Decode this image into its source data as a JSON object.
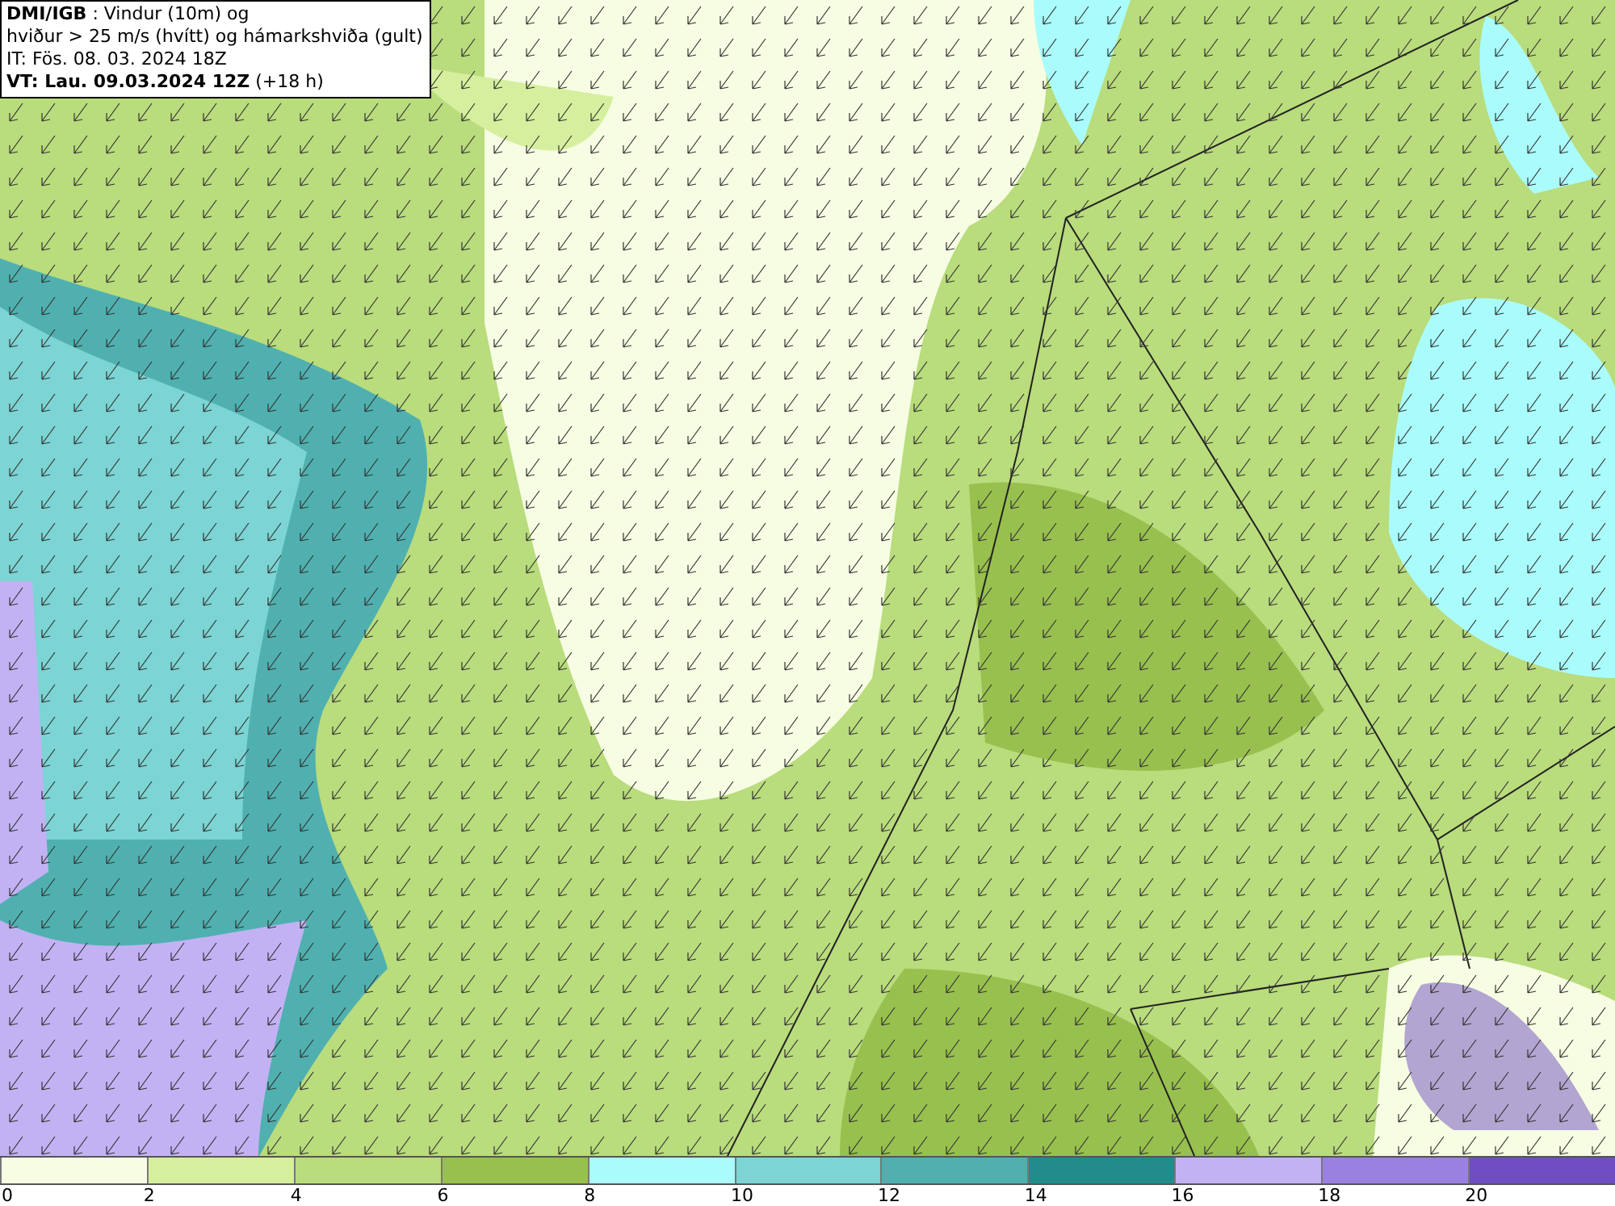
{
  "title_box": {
    "lines": [
      "**DMI/IGB** : Vindur (10m) og",
      "hviður > 25 m/s (hvítt) og hámarkshviða (gult)",
      "IT: Fös. 08. 03. 2024 18Z",
      "**VT: Lau. 09.03.2024 12Z** (+18 h)"
    ]
  },
  "legend": {
    "bins": [
      {
        "label": "0",
        "color": "#f6fde2"
      },
      {
        "label": "2",
        "color": "#d6ef9e"
      },
      {
        "label": "4",
        "color": "#b9dc7c"
      },
      {
        "label": "6",
        "color": "#98c04e"
      },
      {
        "label": "8",
        "color": "#aafcfc"
      },
      {
        "label": "10",
        "color": "#7cd4d4"
      },
      {
        "label": "12",
        "color": "#50b0b0"
      },
      {
        "label": "14",
        "color": "#228c8c"
      },
      {
        "label": "16",
        "color": "#c2b2f4"
      },
      {
        "label": "18",
        "color": "#9a80e0"
      },
      {
        "label": "20",
        "color": "#6e4ec0"
      }
    ]
  }
}
